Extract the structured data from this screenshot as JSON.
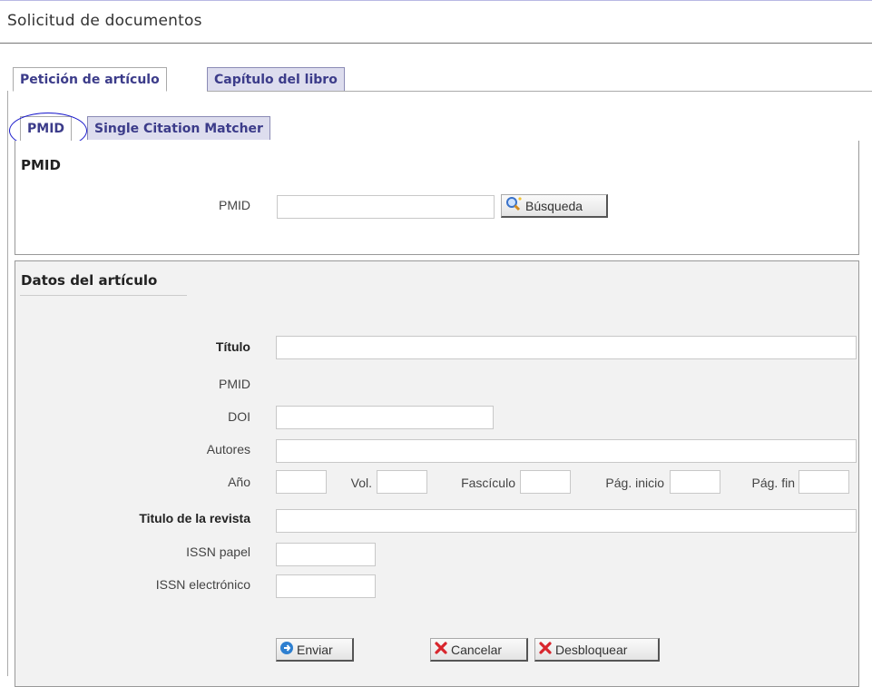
{
  "page": {
    "title": "Solicitud de documentos"
  },
  "tabs_main": [
    {
      "label": "Petición de artículo",
      "active": true
    },
    {
      "label": "Capítulo del libro",
      "active": false
    }
  ],
  "tabs_sub": [
    {
      "label": "PMID",
      "active": true
    },
    {
      "label": "Single Citation Matcher",
      "active": false
    }
  ],
  "pmid_section": {
    "heading": "PMID",
    "field_label": "PMID",
    "field_value": "",
    "search_button": "Búsqueda",
    "search_icon": "magnifier-icon"
  },
  "article": {
    "heading": "Datos del artículo",
    "titulo_label": "Título",
    "pmid_label": "PMID",
    "doi_label": "DOI",
    "autores_label": "Autores",
    "anio_label": "Año",
    "vol_label": "Vol.",
    "fasciculo_label": "Fascículo",
    "pag_inicio_label": "Pág. inicio",
    "pag_fin_label": "Pág. fin",
    "revista_label": "Titulo de la revista",
    "issn_papel_label": "ISSN papel",
    "issn_electronico_label": "ISSN electrónico"
  },
  "buttons": {
    "enviar": "Enviar",
    "cancelar": "Cancelar",
    "desbloquear": "Desbloquear"
  },
  "colors": {
    "tab_text": "#3c3c8a",
    "tab_inactive_bg": "#ddddee",
    "highlight_circle": "#1a1acc"
  }
}
